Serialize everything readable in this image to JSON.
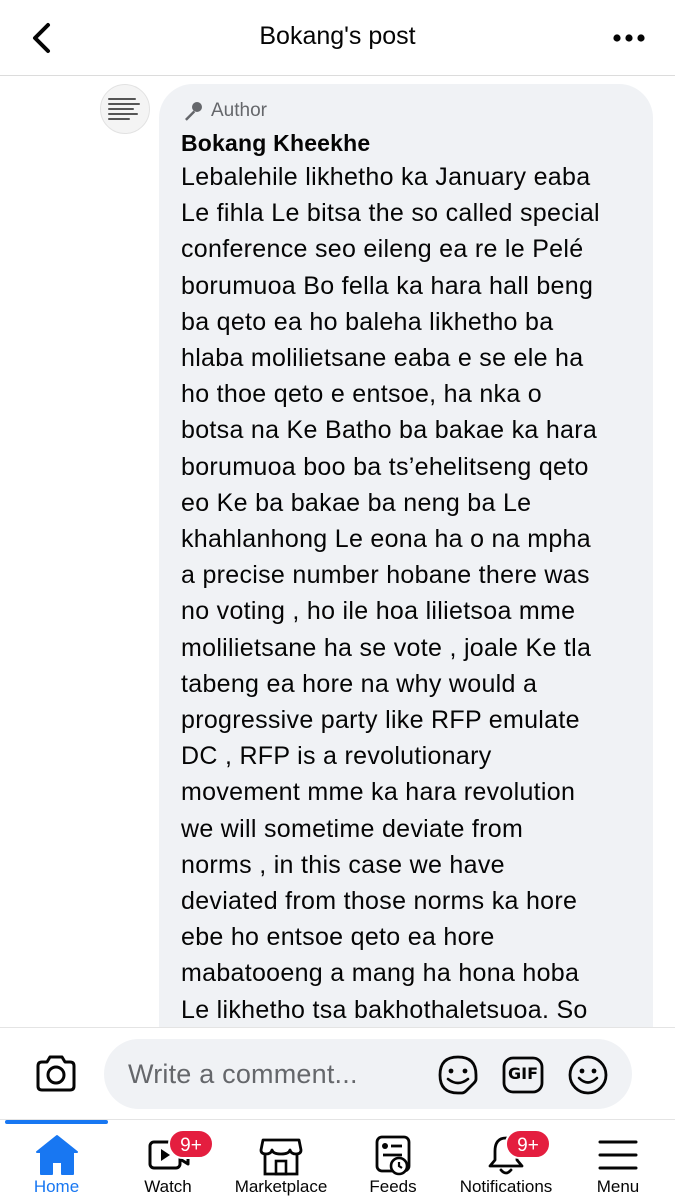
{
  "header": {
    "title": "Bokang's post",
    "back_icon": "chevron-left-icon",
    "more_icon": "more-horizontal-icon"
  },
  "comment": {
    "author_badge": "Author",
    "author_icon": "microphone-icon",
    "author_name": "Bokang Kheekhe",
    "lines": [
      "Lebalehile likhetho ka January eaba",
      "Le fihla Le bitsa the so called special",
      "conference seo eileng ea re le Pelé",
      "borumuoa Bo fella ka hara hall beng",
      "ba qeto ea ho baleha likhetho ba",
      "hlaba molilietsane eaba e se ele ha",
      "ho thoe qeto e entsoe, ha nka o",
      "botsa na Ke Batho ba bakae ka hara",
      "borumuoa boo ba  ts’ehelitseng qeto",
      "eo Ke ba bakae ba neng ba Le",
      "khahlanhong Le eona ha o na mpha",
      "a precise number hobane there was",
      "no voting , ho ile hoa lilietsoa mme",
      "molilietsane ha se vote , joale Ke tla",
      "tabeng ea hore na why would a",
      "progressive party like RFP emulate",
      "DC , RFP is a revolutionary",
      "movement mme ka hara revolution",
      "we will sometime deviate from",
      "norms , in this case we have",
      "deviated from those norms ka hore",
      "ebe ho entsoe qeto ea hore",
      "mabatooeng a mang ha hona hoba",
      "Le likhetho tsa bakhothaletsuoa. So"
    ]
  },
  "composer": {
    "placeholder": "Write a comment...",
    "camera_icon": "camera-icon",
    "sticker_icon": "sticker-icon",
    "gif_label": "GIF",
    "emoji_icon": "emoji-icon"
  },
  "tabs": [
    {
      "label": "Home",
      "icon": "home-icon",
      "active": true,
      "badge": ""
    },
    {
      "label": "Watch",
      "icon": "watch-icon",
      "active": false,
      "badge": "9+"
    },
    {
      "label": "Marketplace",
      "icon": "marketplace-icon",
      "active": false,
      "badge": ""
    },
    {
      "label": "Feeds",
      "icon": "feeds-icon",
      "active": false,
      "badge": ""
    },
    {
      "label": "Notifications",
      "icon": "bell-icon",
      "active": false,
      "badge": "9+"
    },
    {
      "label": "Menu",
      "icon": "menu-icon",
      "active": false,
      "badge": ""
    }
  ],
  "colors": {
    "accent": "#1877f2",
    "badge": "#e41e3f",
    "bubble": "#f0f2f5",
    "secondary_text": "#65676b"
  }
}
